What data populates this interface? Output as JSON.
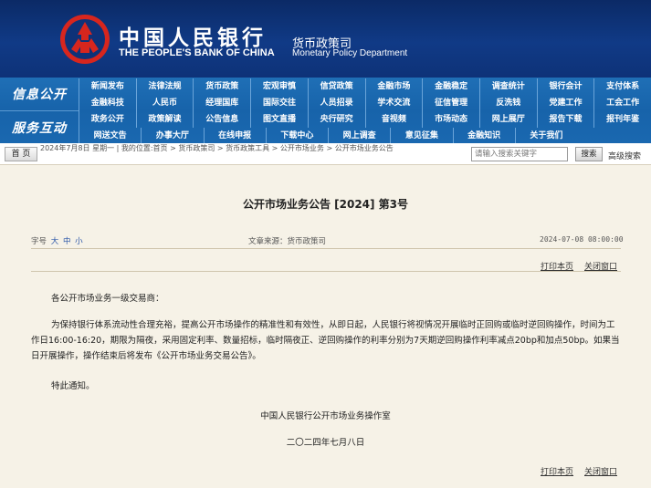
{
  "header": {
    "bank_name_cn": "中国人民银行",
    "bank_name_en": "THE PEOPLE'S BANK OF CHINA",
    "dept_cn": "货币政策司",
    "dept_en": "Monetary Policy Department"
  },
  "nav": {
    "section1": "信息公开",
    "section2": "服务互动",
    "rows": [
      [
        "新闻发布",
        "法律法规",
        "货币政策",
        "宏观审慎",
        "信贷政策",
        "金融市场",
        "金融稳定",
        "调查统计",
        "银行会计",
        "支付体系"
      ],
      [
        "金融科技",
        "人民币",
        "经理国库",
        "国际交往",
        "人员招录",
        "学术交流",
        "征信管理",
        "反洗钱",
        "党建工作",
        "工会工作"
      ],
      [
        "政务公开",
        "政策解读",
        "公告信息",
        "图文直播",
        "央行研究",
        "音视频",
        "市场动态",
        "网上展厅",
        "报告下载",
        "报刊年鉴"
      ],
      [
        "网送文告",
        "办事大厅",
        "在线申报",
        "下载中心",
        "网上调查",
        "意见征集",
        "金融知识",
        "关于我们"
      ]
    ]
  },
  "crumb": {
    "home_label": "首 页",
    "text": "2024年7月8日 星期一 | 我的位置:首页 > 货币政策司 > 货币政策工具 > 公开市场业务 > 公开市场业务公告"
  },
  "search": {
    "placeholder": "请输入搜索关键字",
    "button": "搜索",
    "advanced": "高级搜索"
  },
  "article": {
    "title": "公开市场业务公告  [2024] 第3号",
    "font_label": "字号",
    "font_sizes": [
      "大",
      "中",
      "小"
    ],
    "source": "文章来源：货币政策司",
    "date": "2024-07-08 08:00:00",
    "print": "打印本页",
    "close": "关闭窗口",
    "salutation": "各公开市场业务一级交易商：",
    "paragraph": "为保持银行体系流动性合理充裕，提高公开市场操作的精准性和有效性，从即日起，人民银行将视情况开展临时正回购或临时逆回购操作，时间为工作日16:00-16:20，期限为隔夜，采用固定利率、数量招标，临时隔夜正、逆回购操作的利率分别为7天期逆回购操作利率减点20bp和加点50bp。如果当日开展操作，操作结束后将发布《公开市场业务交易公告》。",
    "notice": "特此通知。",
    "signature": "中国人民银行公开市场业务操作室",
    "sign_date": "二〇二四年七月八日"
  },
  "colors": {
    "header_bg": "#0e3278",
    "nav_bg": "#1763aa",
    "page_bg": "#f6f2e7",
    "emblem_red": "#d7261e"
  }
}
